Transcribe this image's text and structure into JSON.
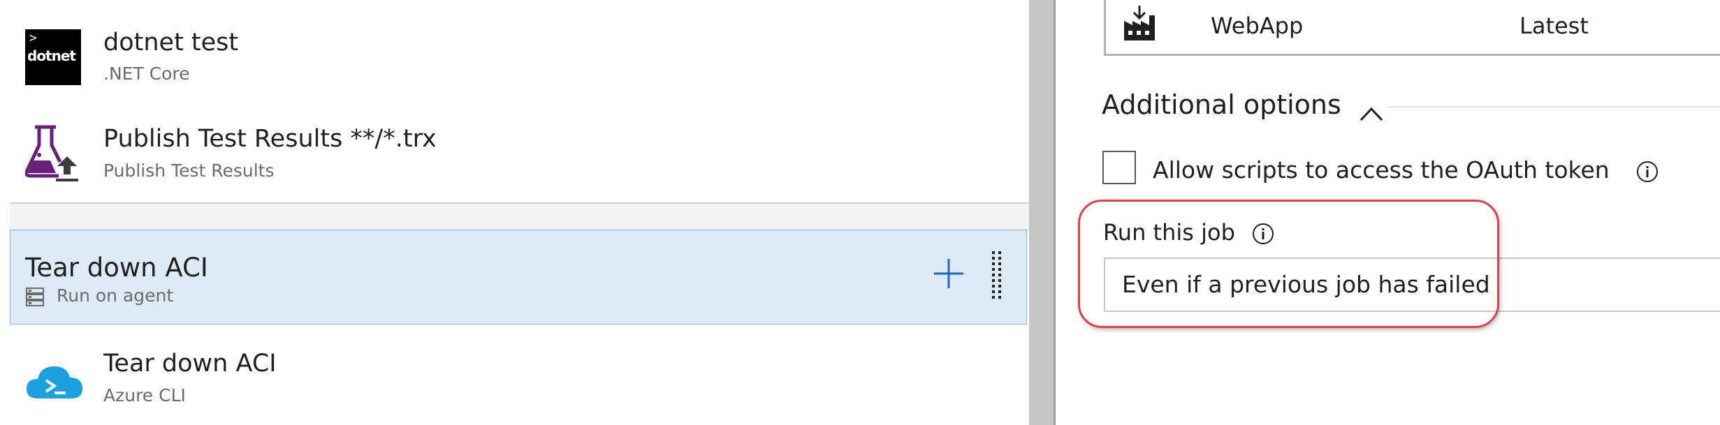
{
  "left": {
    "tasks": [
      {
        "title": "dotnet test",
        "subtitle": ".NET Core",
        "icon": "dotnet-icon",
        "icon_text": "dotnet"
      },
      {
        "title": "Publish Test Results **/*.trx",
        "subtitle": "Publish Test Results",
        "icon": "flask-publish-icon"
      }
    ],
    "job": {
      "title": "Tear down ACI",
      "subtitle": "Run on agent",
      "agent_icon": "server-icon"
    },
    "job_tasks": [
      {
        "title": "Tear down ACI",
        "subtitle": "Azure CLI",
        "icon": "azure-cli-icon"
      }
    ]
  },
  "right": {
    "artifact": {
      "name": "WebApp",
      "version": "Latest",
      "icon": "build-artifact-icon"
    },
    "additional_options": {
      "title": "Additional options",
      "oauth_label": "Allow scripts to access the OAuth token",
      "oauth_checked": false
    },
    "run_this_job": {
      "label": "Run this job",
      "value": "Even if a previous job has failed"
    }
  },
  "colors": {
    "selected_row": "#deebf7",
    "selected_border": "#8ab7e0",
    "accent_blue": "#106ebe",
    "highlight": "#e0404a",
    "flask_purple": "#68217a"
  }
}
